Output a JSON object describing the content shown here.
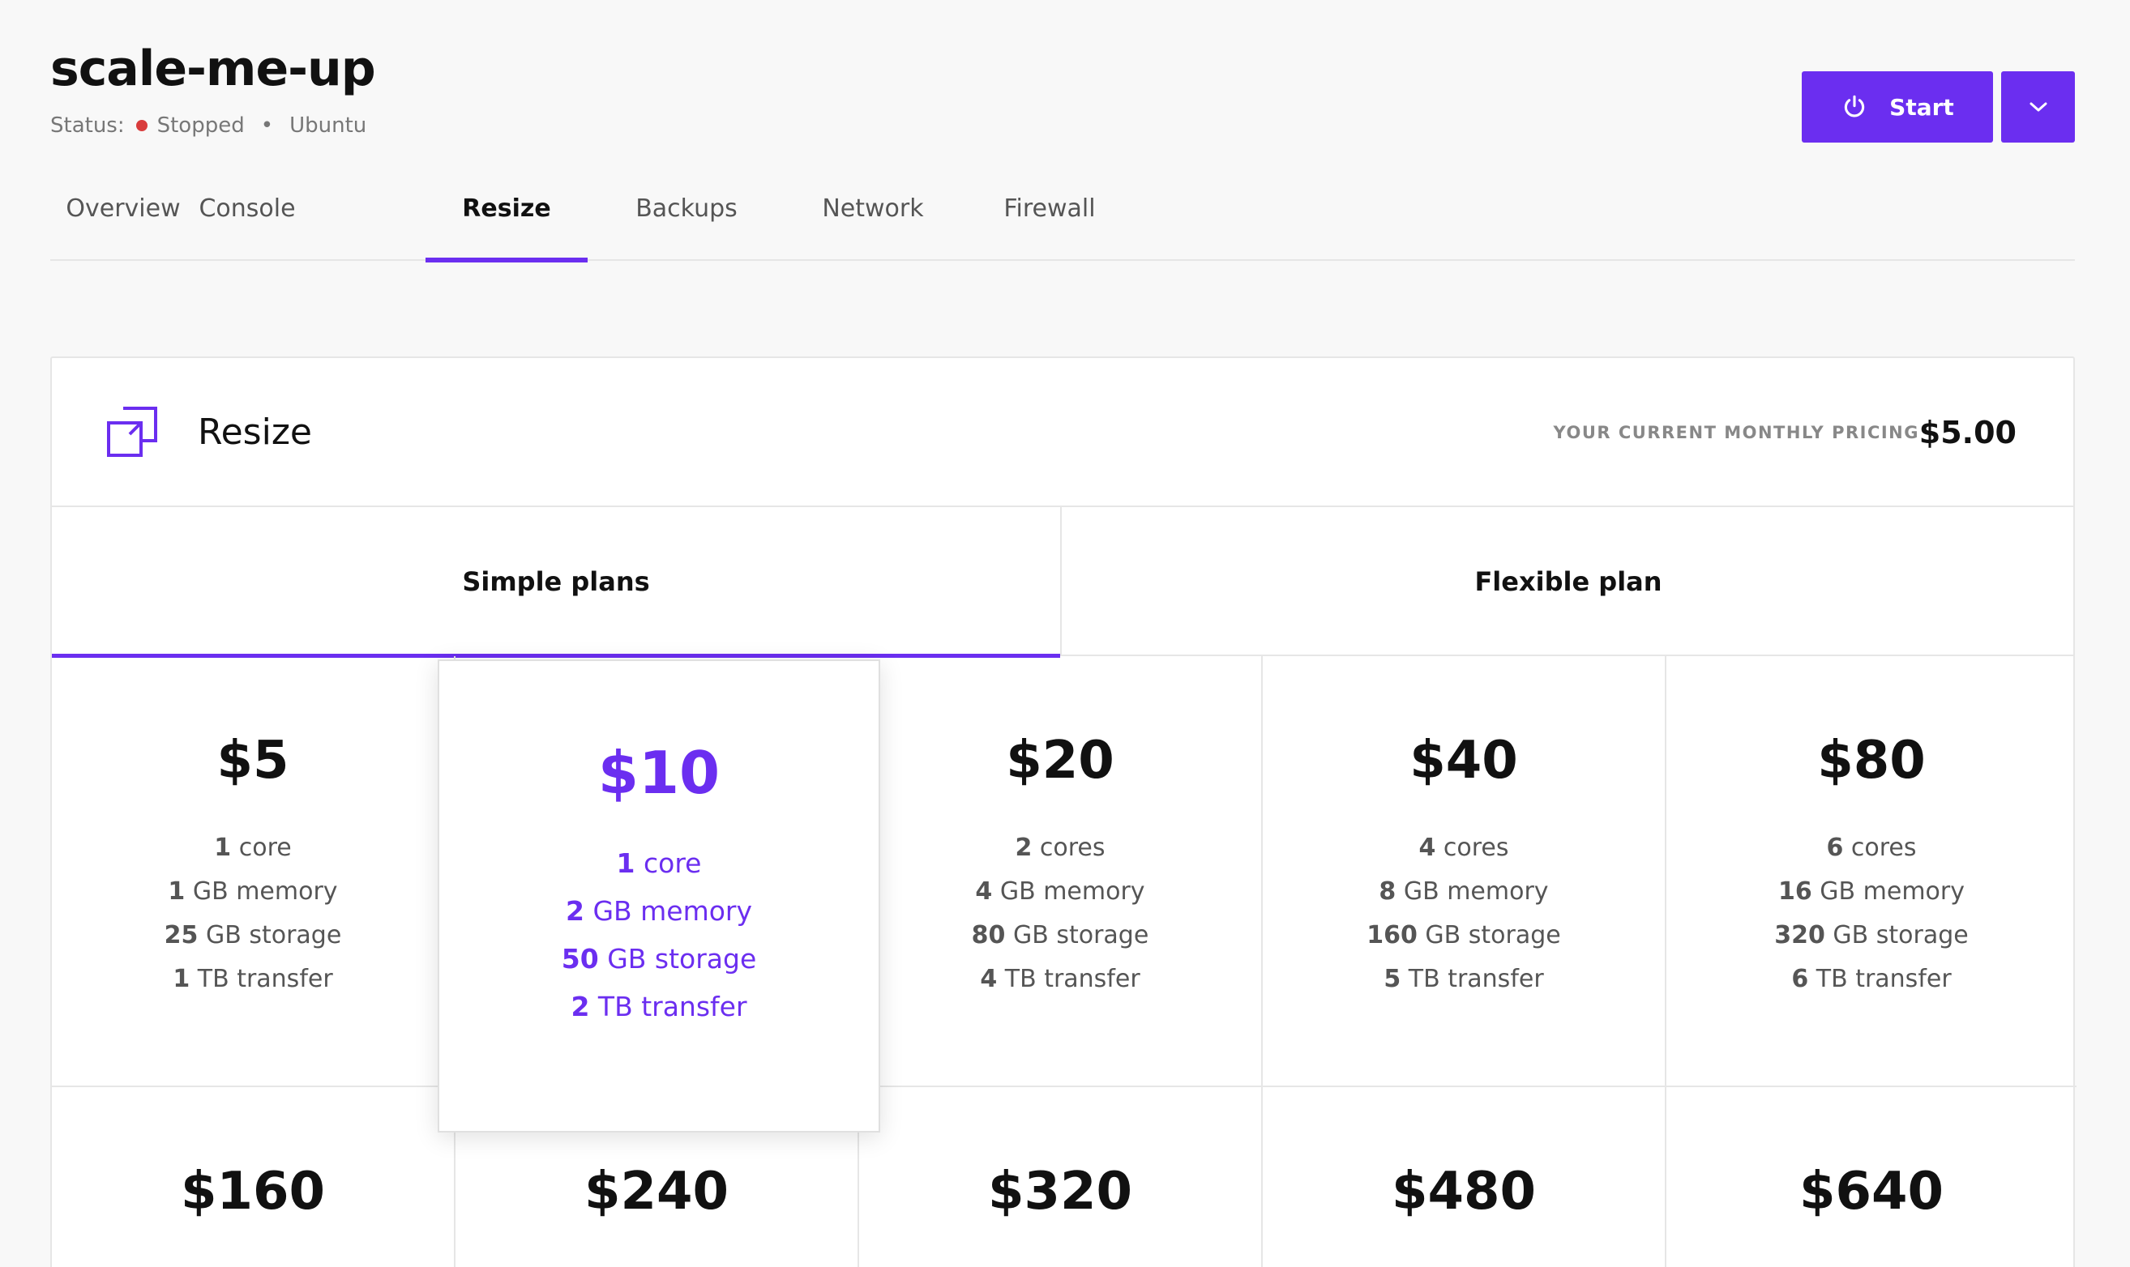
{
  "header": {
    "title": "scale-me-up",
    "status_label": "Status:",
    "status_value": "Stopped",
    "separator": "•",
    "os": "Ubuntu",
    "status_color": "#d93c3c"
  },
  "actions": {
    "start_label": "Start",
    "accent_color": "#6b2ef0"
  },
  "tabs": [
    {
      "label": "Overview"
    },
    {
      "label": "Console"
    },
    {
      "label": "Resize",
      "active": true
    },
    {
      "label": "Backups"
    },
    {
      "label": "Network"
    },
    {
      "label": "Firewall"
    }
  ],
  "card": {
    "title": "Resize",
    "pricing_label": "YOUR CURRENT MONTHLY PRICING",
    "pricing_value": "$5.00",
    "plan_tabs": [
      {
        "label": "Simple plans",
        "active": true
      },
      {
        "label": "Flexible plan"
      }
    ],
    "plans": [
      {
        "price": "$5",
        "cores": "1",
        "cores_unit": "core",
        "memory": "1",
        "storage": "25",
        "transfer": "1"
      },
      {
        "price": "$10",
        "cores": "1",
        "cores_unit": "core",
        "memory": "2",
        "storage": "50",
        "transfer": "2",
        "selected": true
      },
      {
        "price": "$20",
        "cores": "2",
        "cores_unit": "cores",
        "memory": "4",
        "storage": "80",
        "transfer": "4"
      },
      {
        "price": "$40",
        "cores": "4",
        "cores_unit": "cores",
        "memory": "8",
        "storage": "160",
        "transfer": "5"
      },
      {
        "price": "$80",
        "cores": "6",
        "cores_unit": "cores",
        "memory": "16",
        "storage": "320",
        "transfer": "6"
      },
      {
        "price": "$160"
      },
      {
        "price": "$240"
      },
      {
        "price": "$320"
      },
      {
        "price": "$480"
      },
      {
        "price": "$640"
      }
    ],
    "units": {
      "memory": "GB memory",
      "storage": "GB storage",
      "transfer": "TB transfer"
    }
  }
}
